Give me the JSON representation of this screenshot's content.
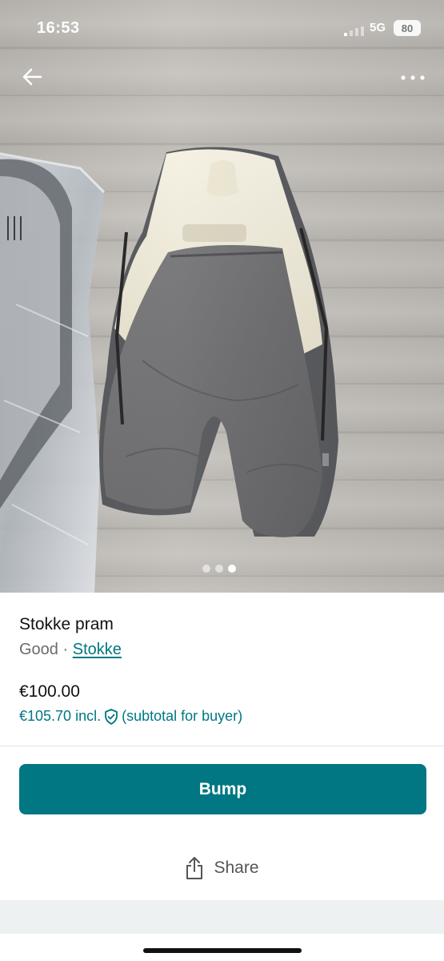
{
  "status_bar": {
    "time": "16:53",
    "network": "5G",
    "battery": "80"
  },
  "gallery": {
    "image_count": 3,
    "active_index": 2,
    "image_subject": "grey and cream baby foot muff on a wooden floor"
  },
  "icons": {
    "back": "arrow-left-icon",
    "more": "more-dots-icon",
    "shield": "shield-check-icon",
    "share": "share-icon"
  },
  "item": {
    "title": "Stokke pram",
    "condition": "Good",
    "separator": "·",
    "brand": "Stokke",
    "price": "€100.00",
    "price_incl": "€105.70 incl.",
    "price_incl_note": "(subtotal for buyer)"
  },
  "actions": {
    "bump_label": "Bump",
    "share_label": "Share"
  },
  "colors": {
    "accent": "#007782",
    "bump_text": "#ffffff",
    "secondary_text": "#6b6b6b",
    "bottom_band": "#eef1f2"
  }
}
